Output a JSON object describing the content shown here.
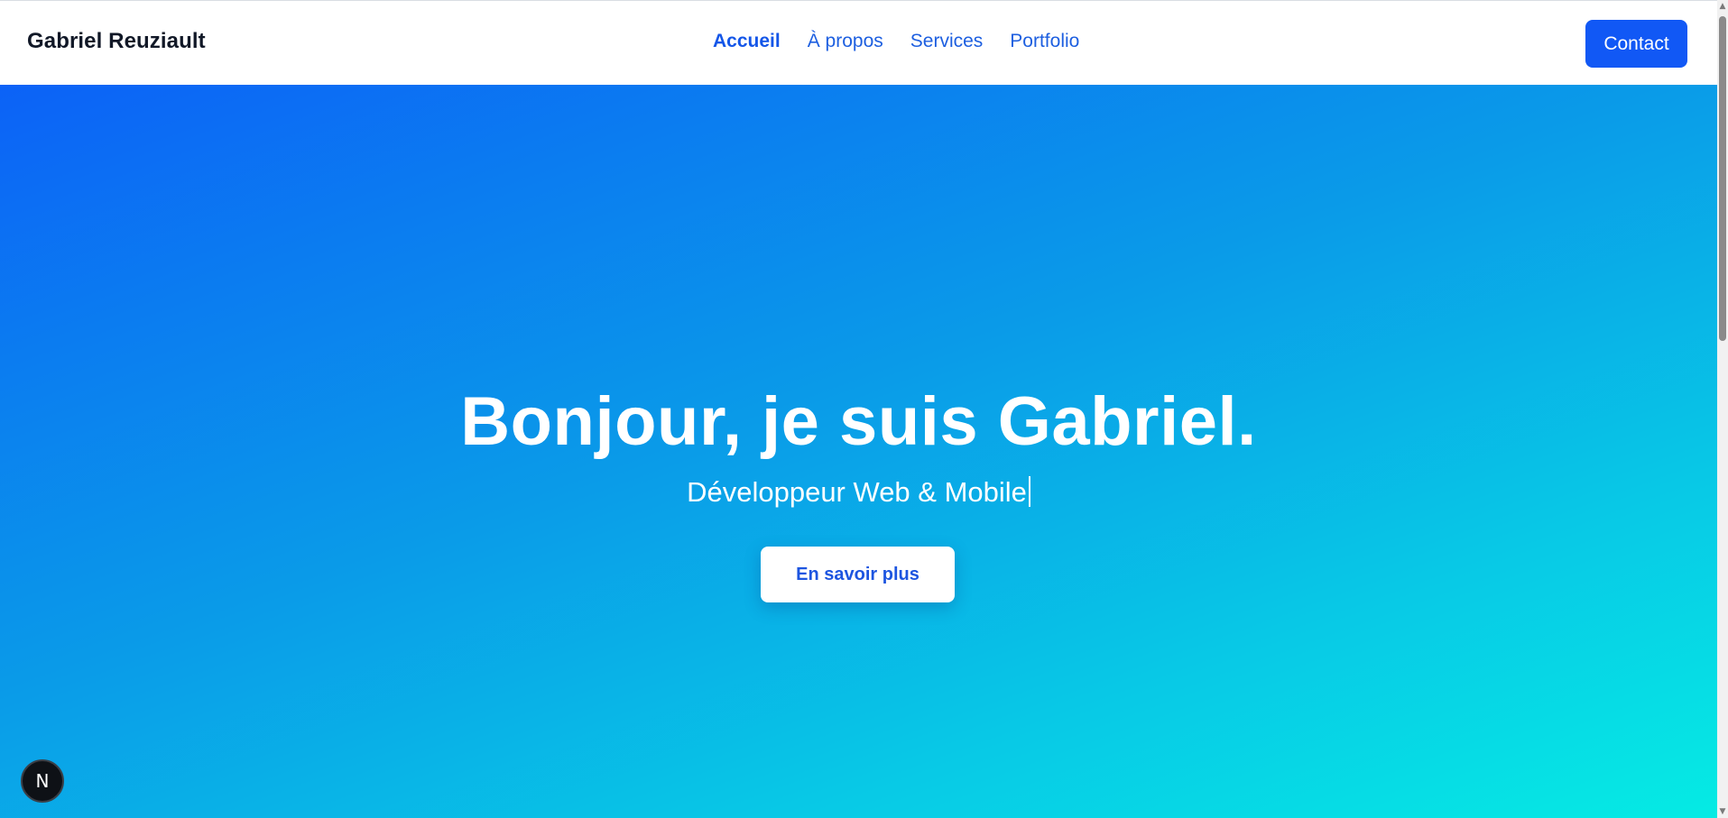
{
  "header": {
    "brand": "Gabriel Reuziault",
    "nav": [
      {
        "label": "Accueil",
        "active": true
      },
      {
        "label": "À propos",
        "active": false
      },
      {
        "label": "Services",
        "active": false
      },
      {
        "label": "Portfolio",
        "active": false
      }
    ],
    "contact_label": "Contact"
  },
  "hero": {
    "title": "Bonjour, je suis Gabriel.",
    "subtitle": "Développeur Web & Mobile",
    "cta_label": "En savoir plus"
  },
  "dev_indicator": {
    "letter": "N",
    "icon": "nextjs-icon"
  },
  "colors": {
    "accent": "#1158f5",
    "nav_link": "#1d5fe0",
    "gradient_start": "#0c62f7",
    "gradient_end": "#05ebe4"
  }
}
